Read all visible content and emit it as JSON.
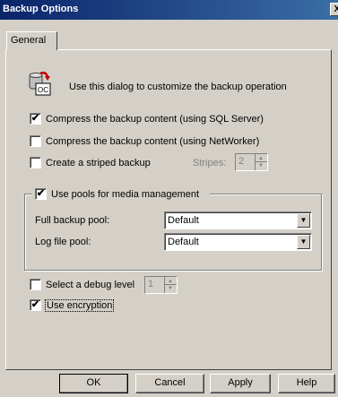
{
  "window": {
    "title": "Backup Options",
    "close_glyph": "X"
  },
  "tabs": [
    {
      "label": "General"
    }
  ],
  "intro": {
    "icon": "backup-dialog-icon",
    "text": "Use this dialog to customize the backup operation"
  },
  "options": {
    "compress_sql": {
      "label": "Compress the backup content (using SQL Server)",
      "checked": true
    },
    "compress_networker": {
      "label": "Compress the backup content (using NetWorker)",
      "checked": false
    },
    "striped": {
      "label": "Create a striped backup",
      "checked": false
    },
    "stripes": {
      "label": "Stripes:",
      "value": "2",
      "enabled": false
    }
  },
  "pools": {
    "label": "Use pools for media management",
    "checked": true,
    "full_backup_pool": {
      "label": "Full backup pool:",
      "value": "Default"
    },
    "log_file_pool": {
      "label": "Log file pool:",
      "value": "Default"
    }
  },
  "debug": {
    "label": "Select a debug level",
    "checked": false,
    "value": "1"
  },
  "encryption": {
    "label": "Use encryption",
    "checked": true
  },
  "buttons": {
    "ok": "OK",
    "cancel": "Cancel",
    "apply": "Apply",
    "help": "Help"
  },
  "glyphs": {
    "check": "✔",
    "up": "▲",
    "down": "▼"
  }
}
